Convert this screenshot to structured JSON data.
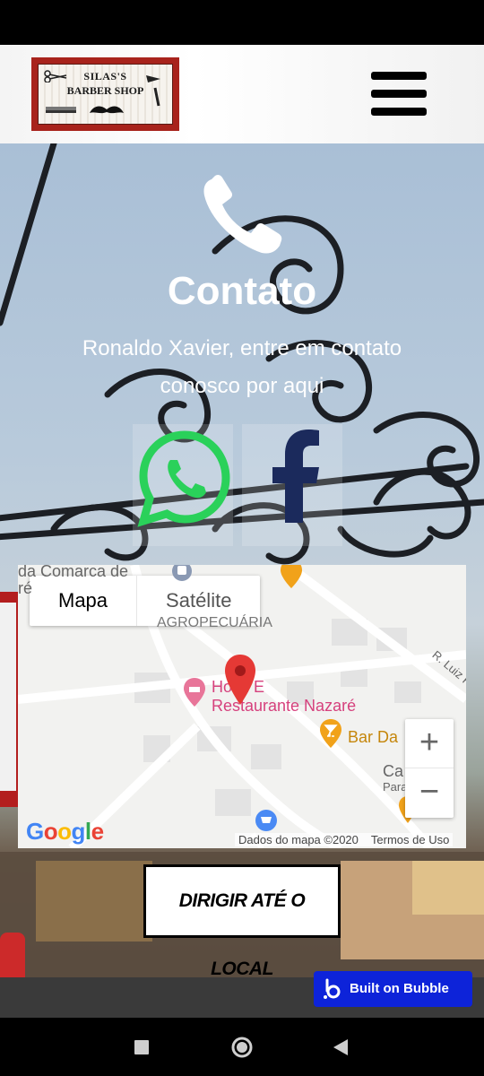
{
  "header": {
    "logo_line1": "SILAS'S",
    "logo_line2": "BARBER SHOP"
  },
  "contact": {
    "title": "Contato",
    "subtitle": "Ronaldo Xavier, entre em contato conosco por aqui"
  },
  "social": {
    "whatsapp_icon": "whatsapp-icon",
    "facebook_icon": "facebook-icon",
    "whatsapp_color": "#25d366",
    "facebook_color": "#1b2a5c"
  },
  "map": {
    "tab_map": "Mapa",
    "tab_satellite": "Satélite",
    "label_comarca": "da Comarca de",
    "label_comarca2": "ré",
    "label_agro": "AGROPECUÁRIA",
    "label_hotel1": "Hotel E",
    "label_hotel2": "Restaurante Nazaré",
    "label_bar": "Bar Da",
    "label_street": "R. Luiz R",
    "label_ca": "Ca",
    "label_para": "Para",
    "google": "Google",
    "map_data": "Dados do mapa ©2020",
    "terms": "Termos de Uso",
    "zoom_in": "+",
    "zoom_out": "−"
  },
  "directions_button": "DIRIGIR ATÉ O LOCAL",
  "bubble_badge": "Built on Bubble",
  "colors": {
    "pin": "#e53935",
    "bubble": "#0d23d9",
    "logo_frame": "#a8231c"
  }
}
